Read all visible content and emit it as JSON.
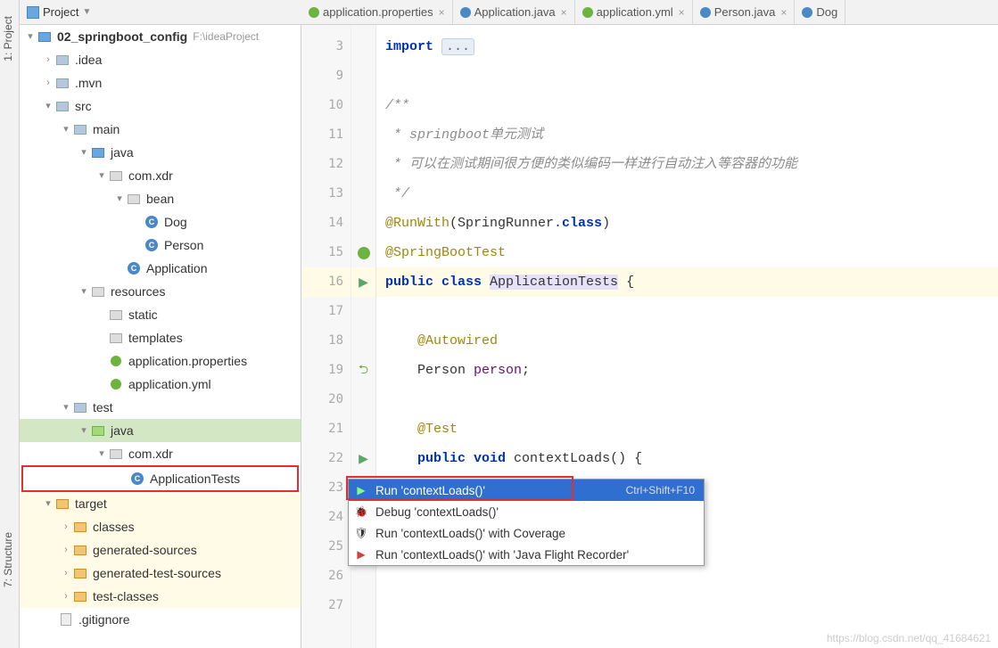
{
  "sideTabs": {
    "project": "1: Project",
    "structure": "7: Structure"
  },
  "toolwindow": {
    "title": "Project"
  },
  "editorTabs": [
    {
      "label": "application.properties",
      "icon": "spring"
    },
    {
      "label": "Application.java",
      "icon": "java"
    },
    {
      "label": "application.yml",
      "icon": "spring"
    },
    {
      "label": "Person.java",
      "icon": "java"
    },
    {
      "label": "Dog",
      "icon": "java"
    }
  ],
  "tree": {
    "root": {
      "name": "02_springboot_config",
      "path": "F:\\ideaProject"
    },
    "idea": ".idea",
    "mvn": ".mvn",
    "src": "src",
    "main": "main",
    "java": "java",
    "pkg_main": "com.xdr",
    "bean": "bean",
    "dog": "Dog",
    "person": "Person",
    "application": "Application",
    "resources": "resources",
    "static": "static",
    "templates": "templates",
    "app_props": "application.properties",
    "app_yml": "application.yml",
    "test": "test",
    "java2": "java",
    "pkg_test": "com.xdr",
    "apptests": "ApplicationTests",
    "target": "target",
    "classes": "classes",
    "gensrc": "generated-sources",
    "gentestsrc": "generated-test-sources",
    "testclasses": "test-classes",
    "gitignore": ".gitignore"
  },
  "code": {
    "l3": "import ",
    "l3b": "...",
    "l10": "/**",
    "l11": " * springboot单元测试",
    "l12": " * 可以在测试期间很方便的类似编码一样进行自动注入等容器的功能",
    "l13": " */",
    "l14a": "@RunWith",
    "l14b": "(SpringRunner.",
    "l14c": "class",
    "l14d": ")",
    "l15": "@SpringBootTest",
    "l16a": "public class ",
    "l16b": "ApplicationTests",
    "l16c": " {",
    "l18": "@Autowired",
    "l19a": "Person ",
    "l19b": "person",
    "l19c": ";",
    "l21": "@Test",
    "l22a": "public void ",
    "l22b": "contextLoads",
    "l22c": "() {",
    "l25": "}",
    "lineNums": [
      "3",
      "9",
      "10",
      "11",
      "12",
      "13",
      "14",
      "15",
      "16",
      "17",
      "18",
      "19",
      "20",
      "21",
      "22",
      "23",
      "24",
      "25",
      "26",
      "27"
    ]
  },
  "menu": {
    "run": "Run 'contextLoads()'",
    "runShortcut": "Ctrl+Shift+F10",
    "debug": "Debug 'contextLoads()'",
    "coverage": "Run 'contextLoads()' with Coverage",
    "jfr": "Run 'contextLoads()' with 'Java Flight Recorder'"
  },
  "watermark": "https://blog.csdn.net/qq_41684621"
}
